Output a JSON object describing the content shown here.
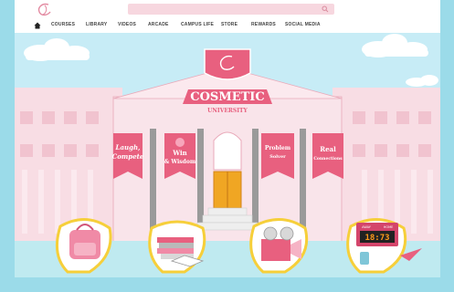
{
  "nav": {
    "items": [
      {
        "label": "COURSES"
      },
      {
        "label": "LIBRARY"
      },
      {
        "label": "VIDEOS"
      },
      {
        "label": "ARCADE"
      },
      {
        "label": "CAMPUS LIFE"
      },
      {
        "label": "STORE"
      },
      {
        "label": "REWARDS"
      },
      {
        "label": "SOCIAL MEDIA"
      }
    ]
  },
  "crest": {
    "title": "COSMETIC",
    "subtitle": "UNIVERSITY"
  },
  "banners": [
    {
      "line1": "Laugh,",
      "line2": "Compete"
    },
    {
      "line1": "Win",
      "line2": "& Wisdom"
    },
    {
      "line1": "Problem",
      "line2": "Solver"
    },
    {
      "line1": "Real",
      "line2": "Connections"
    }
  ],
  "scoreboard": {
    "left_label": "AWAY",
    "right_label": "HOME",
    "digits": "18:73"
  },
  "colors": {
    "accent": "#e8607f",
    "sky": "#c7ecf6",
    "building": "#f6d7df"
  }
}
